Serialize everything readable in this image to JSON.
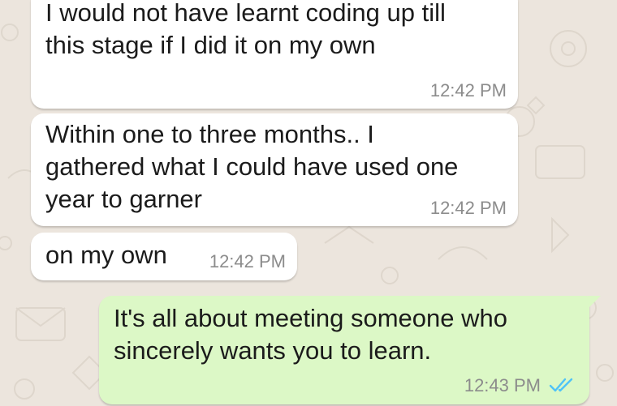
{
  "colors": {
    "wallpaper": "#ece5dd",
    "incoming_bubble": "#ffffff",
    "outgoing_bubble": "#dcf8c6",
    "timestamp": "#8c8c8c",
    "read_ticks": "#4fc3f7"
  },
  "messages": [
    {
      "direction": "incoming",
      "text": "I would not have learnt coding up till\nthis stage if I did it on my own",
      "time": "12:42 PM"
    },
    {
      "direction": "incoming",
      "text": "Within one to three months.. I\ngathered what I could have used one\nyear to garner",
      "time": "12:42 PM"
    },
    {
      "direction": "incoming",
      "text": "on my own",
      "time": "12:42 PM"
    },
    {
      "direction": "outgoing",
      "text": "It's all about meeting someone who\nsincerely wants you to learn.",
      "time": "12:43 PM",
      "status_icon": "double-check-read-icon"
    }
  ]
}
